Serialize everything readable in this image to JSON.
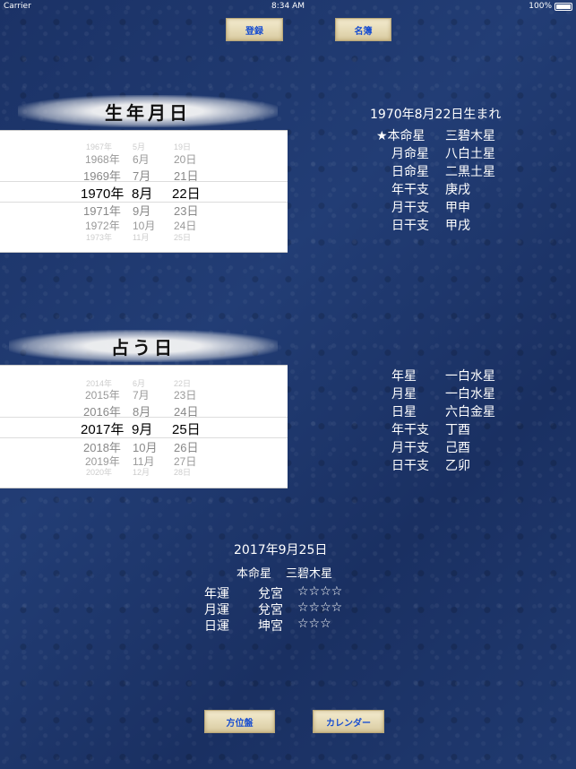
{
  "status": {
    "carrier": "Carrier",
    "time": "8:34 AM",
    "battery": "100%"
  },
  "top_buttons": {
    "register": "登録",
    "roster": "名簿"
  },
  "birth_header": "生年月日",
  "birth_picker": {
    "rows": [
      {
        "y": "1967年",
        "m": "5月",
        "d": "19日"
      },
      {
        "y": "1968年",
        "m": "6月",
        "d": "20日"
      },
      {
        "y": "1969年",
        "m": "7月",
        "d": "21日"
      },
      {
        "y": "1970年",
        "m": "8月",
        "d": "22日"
      },
      {
        "y": "1971年",
        "m": "9月",
        "d": "23日"
      },
      {
        "y": "1972年",
        "m": "10月",
        "d": "24日"
      },
      {
        "y": "1973年",
        "m": "11月",
        "d": "25日"
      }
    ]
  },
  "birth_info": {
    "title": "1970年8月22日生まれ",
    "rows": [
      {
        "label": "★本命星",
        "value": "三碧木星"
      },
      {
        "label": "月命星",
        "value": "八白土星"
      },
      {
        "label": "日命星",
        "value": "二黒土星"
      },
      {
        "label": "年干支",
        "value": "庚戌"
      },
      {
        "label": "月干支",
        "value": "甲申"
      },
      {
        "label": "日干支",
        "value": "甲戌"
      }
    ]
  },
  "fortune_header": "占う日",
  "fortune_picker": {
    "rows": [
      {
        "y": "2014年",
        "m": "6月",
        "d": "22日"
      },
      {
        "y": "2015年",
        "m": "7月",
        "d": "23日"
      },
      {
        "y": "2016年",
        "m": "8月",
        "d": "24日"
      },
      {
        "y": "2017年",
        "m": "9月",
        "d": "25日"
      },
      {
        "y": "2018年",
        "m": "10月",
        "d": "26日"
      },
      {
        "y": "2019年",
        "m": "11月",
        "d": "27日"
      },
      {
        "y": "2020年",
        "m": "12月",
        "d": "28日"
      }
    ]
  },
  "fortune_info": {
    "rows": [
      {
        "label": "年星",
        "value": "一白水星"
      },
      {
        "label": "月星",
        "value": "一白水星"
      },
      {
        "label": "日星",
        "value": "六白金星"
      },
      {
        "label": "年干支",
        "value": "丁酉"
      },
      {
        "label": "月干支",
        "value": "己酉"
      },
      {
        "label": "日干支",
        "value": "乙卯"
      }
    ]
  },
  "summary": {
    "date": "2017年9月25日",
    "star_label": "本命星",
    "star_value": "三碧木星",
    "rows": [
      {
        "label": "年運",
        "palace": "兌宮",
        "rating": "☆☆☆☆"
      },
      {
        "label": "月運",
        "palace": "兌宮",
        "rating": "☆☆☆☆"
      },
      {
        "label": "日運",
        "palace": "坤宮",
        "rating": "☆☆☆"
      }
    ]
  },
  "bottom_buttons": {
    "direction": "方位盤",
    "calendar": "カレンダー"
  }
}
